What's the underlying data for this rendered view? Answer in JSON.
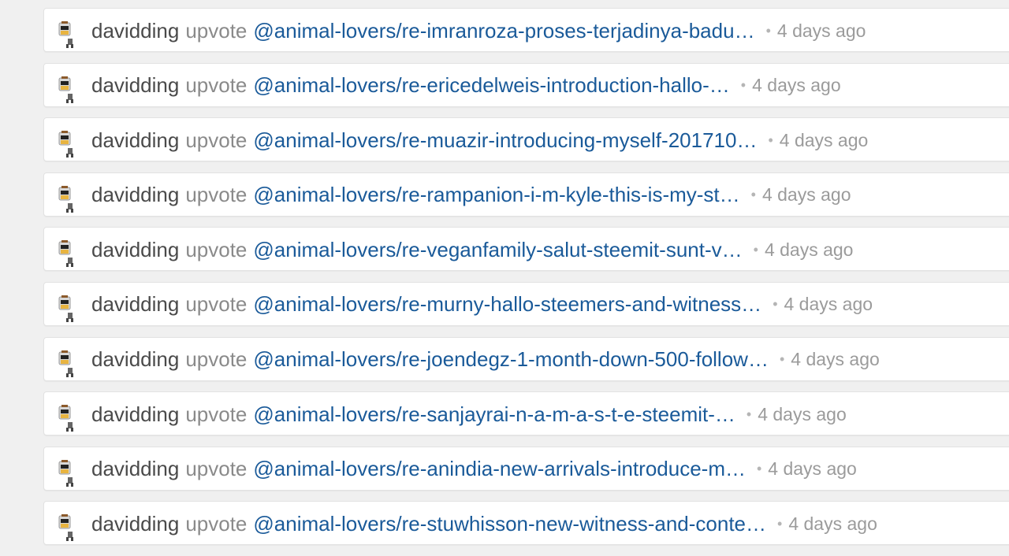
{
  "feed": {
    "items": [
      {
        "author": "davidding",
        "action": "upvote",
        "link": "@animal-lovers/re-imranroza-proses-terjadinya-badu…",
        "time": "4 days ago"
      },
      {
        "author": "davidding",
        "action": "upvote",
        "link": "@animal-lovers/re-ericedelweis-introduction-hallo-…",
        "time": "4 days ago"
      },
      {
        "author": "davidding",
        "action": "upvote",
        "link": "@animal-lovers/re-muazir-introducing-myself-201710…",
        "time": "4 days ago"
      },
      {
        "author": "davidding",
        "action": "upvote",
        "link": "@animal-lovers/re-rampanion-i-m-kyle-this-is-my-st…",
        "time": "4 days ago"
      },
      {
        "author": "davidding",
        "action": "upvote",
        "link": "@animal-lovers/re-veganfamily-salut-steemit-sunt-v…",
        "time": "4 days ago"
      },
      {
        "author": "davidding",
        "action": "upvote",
        "link": "@animal-lovers/re-murny-hallo-steemers-and-witness…",
        "time": "4 days ago"
      },
      {
        "author": "davidding",
        "action": "upvote",
        "link": "@animal-lovers/re-joendegz-1-month-down-500-follow…",
        "time": "4 days ago"
      },
      {
        "author": "davidding",
        "action": "upvote",
        "link": "@animal-lovers/re-sanjayrai-n-a-m-a-s-t-e-steemit-…",
        "time": "4 days ago"
      },
      {
        "author": "davidding",
        "action": "upvote",
        "link": "@animal-lovers/re-anindia-new-arrivals-introduce-m…",
        "time": "4 days ago"
      },
      {
        "author": "davidding",
        "action": "upvote",
        "link": "@animal-lovers/re-stuwhisson-new-witness-and-conte…",
        "time": "4 days ago"
      }
    ],
    "separator": "•",
    "avatar_icon": "robot-avatar-icon"
  },
  "colors": {
    "author": "#4a4a4a",
    "action": "#8a8a8a",
    "link": "#1a5a99",
    "time": "#9b9b9b",
    "background": "#f0f0f0"
  }
}
